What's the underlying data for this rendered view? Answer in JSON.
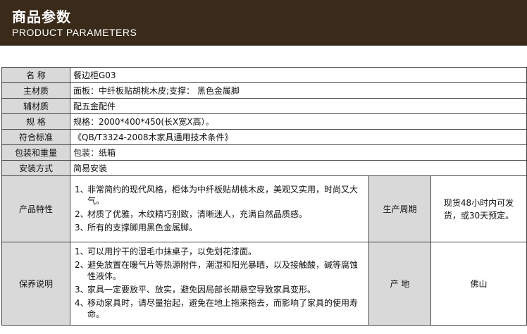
{
  "header": {
    "title_cn": "商品参数",
    "title_en": "PRODUCT PARAMETERS"
  },
  "rows": [
    {
      "label": "名 称",
      "value": "餐边柜G03"
    },
    {
      "label": "主材质",
      "value": "面板：中纤板贴胡桃木皮;支撑： 黑色金属脚"
    },
    {
      "label": "辅材质",
      "value": "配五金配件"
    },
    {
      "label": "规 格",
      "value": "规格：2000*400*450(长X宽X高）。"
    },
    {
      "label": "符合标准",
      "value": "《QB/T3324-2008木家具通用技术条件》"
    },
    {
      "label": "包装和重量",
      "value": "包装：纸箱"
    },
    {
      "label": "安装方式",
      "value": "简易安装"
    }
  ],
  "features": {
    "label": "产品特性",
    "items": [
      {
        "num": "1、",
        "text": "非常简约的现代风格，柜体为中纤板贴胡桃木皮，美观又实用，时尚又大气。"
      },
      {
        "num": "2、",
        "text": "材质了优雅，木纹精巧别致，清晰迷人，充满自然品质感。"
      },
      {
        "num": "3、",
        "text": "所有的支撑脚用黑色金属脚。"
      }
    ],
    "side_label": "生产周期",
    "side_value": "现货48小时内可发货，或30天预定。"
  },
  "care": {
    "label": "保养说明",
    "items": [
      {
        "num": "1、",
        "text": "可以用拧干的湿毛巾抹桌子，以免划花漆面。"
      },
      {
        "num": "2、",
        "text": "避免放置在暖气片等热源附件，潮湿和阳光暴晒，以及接触酸，碱等腐蚀性液体。"
      },
      {
        "num": "3、",
        "text": "家具一定要放平、放实，避免因局部长期悬空导致家具变形。"
      },
      {
        "num": "4、",
        "text": "移动家具时，请尽量抬起，避免在地上拖来拖去，而影响了家具的使用寿命。"
      }
    ],
    "side_label": "产 地",
    "side_value": "佛山"
  }
}
